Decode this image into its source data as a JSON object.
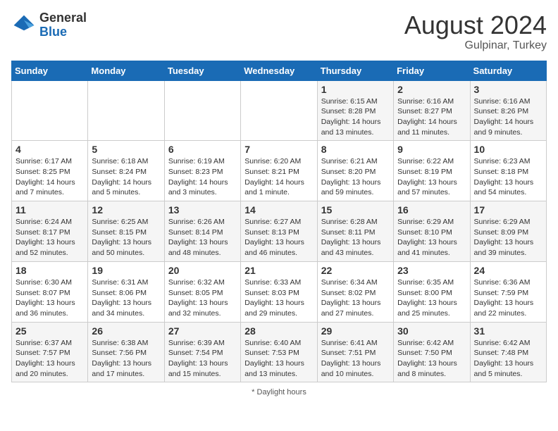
{
  "header": {
    "logo_general": "General",
    "logo_blue": "Blue",
    "month_year": "August 2024",
    "location": "Gulpinar, Turkey"
  },
  "days_of_week": [
    "Sunday",
    "Monday",
    "Tuesday",
    "Wednesday",
    "Thursday",
    "Friday",
    "Saturday"
  ],
  "weeks": [
    [
      {
        "day": "",
        "info": ""
      },
      {
        "day": "",
        "info": ""
      },
      {
        "day": "",
        "info": ""
      },
      {
        "day": "",
        "info": ""
      },
      {
        "day": "1",
        "info": "Sunrise: 6:15 AM\nSunset: 8:28 PM\nDaylight: 14 hours and 13 minutes."
      },
      {
        "day": "2",
        "info": "Sunrise: 6:16 AM\nSunset: 8:27 PM\nDaylight: 14 hours and 11 minutes."
      },
      {
        "day": "3",
        "info": "Sunrise: 6:16 AM\nSunset: 8:26 PM\nDaylight: 14 hours and 9 minutes."
      }
    ],
    [
      {
        "day": "4",
        "info": "Sunrise: 6:17 AM\nSunset: 8:25 PM\nDaylight: 14 hours and 7 minutes."
      },
      {
        "day": "5",
        "info": "Sunrise: 6:18 AM\nSunset: 8:24 PM\nDaylight: 14 hours and 5 minutes."
      },
      {
        "day": "6",
        "info": "Sunrise: 6:19 AM\nSunset: 8:23 PM\nDaylight: 14 hours and 3 minutes."
      },
      {
        "day": "7",
        "info": "Sunrise: 6:20 AM\nSunset: 8:21 PM\nDaylight: 14 hours and 1 minute."
      },
      {
        "day": "8",
        "info": "Sunrise: 6:21 AM\nSunset: 8:20 PM\nDaylight: 13 hours and 59 minutes."
      },
      {
        "day": "9",
        "info": "Sunrise: 6:22 AM\nSunset: 8:19 PM\nDaylight: 13 hours and 57 minutes."
      },
      {
        "day": "10",
        "info": "Sunrise: 6:23 AM\nSunset: 8:18 PM\nDaylight: 13 hours and 54 minutes."
      }
    ],
    [
      {
        "day": "11",
        "info": "Sunrise: 6:24 AM\nSunset: 8:17 PM\nDaylight: 13 hours and 52 minutes."
      },
      {
        "day": "12",
        "info": "Sunrise: 6:25 AM\nSunset: 8:15 PM\nDaylight: 13 hours and 50 minutes."
      },
      {
        "day": "13",
        "info": "Sunrise: 6:26 AM\nSunset: 8:14 PM\nDaylight: 13 hours and 48 minutes."
      },
      {
        "day": "14",
        "info": "Sunrise: 6:27 AM\nSunset: 8:13 PM\nDaylight: 13 hours and 46 minutes."
      },
      {
        "day": "15",
        "info": "Sunrise: 6:28 AM\nSunset: 8:11 PM\nDaylight: 13 hours and 43 minutes."
      },
      {
        "day": "16",
        "info": "Sunrise: 6:29 AM\nSunset: 8:10 PM\nDaylight: 13 hours and 41 minutes."
      },
      {
        "day": "17",
        "info": "Sunrise: 6:29 AM\nSunset: 8:09 PM\nDaylight: 13 hours and 39 minutes."
      }
    ],
    [
      {
        "day": "18",
        "info": "Sunrise: 6:30 AM\nSunset: 8:07 PM\nDaylight: 13 hours and 36 minutes."
      },
      {
        "day": "19",
        "info": "Sunrise: 6:31 AM\nSunset: 8:06 PM\nDaylight: 13 hours and 34 minutes."
      },
      {
        "day": "20",
        "info": "Sunrise: 6:32 AM\nSunset: 8:05 PM\nDaylight: 13 hours and 32 minutes."
      },
      {
        "day": "21",
        "info": "Sunrise: 6:33 AM\nSunset: 8:03 PM\nDaylight: 13 hours and 29 minutes."
      },
      {
        "day": "22",
        "info": "Sunrise: 6:34 AM\nSunset: 8:02 PM\nDaylight: 13 hours and 27 minutes."
      },
      {
        "day": "23",
        "info": "Sunrise: 6:35 AM\nSunset: 8:00 PM\nDaylight: 13 hours and 25 minutes."
      },
      {
        "day": "24",
        "info": "Sunrise: 6:36 AM\nSunset: 7:59 PM\nDaylight: 13 hours and 22 minutes."
      }
    ],
    [
      {
        "day": "25",
        "info": "Sunrise: 6:37 AM\nSunset: 7:57 PM\nDaylight: 13 hours and 20 minutes."
      },
      {
        "day": "26",
        "info": "Sunrise: 6:38 AM\nSunset: 7:56 PM\nDaylight: 13 hours and 17 minutes."
      },
      {
        "day": "27",
        "info": "Sunrise: 6:39 AM\nSunset: 7:54 PM\nDaylight: 13 hours and 15 minutes."
      },
      {
        "day": "28",
        "info": "Sunrise: 6:40 AM\nSunset: 7:53 PM\nDaylight: 13 hours and 13 minutes."
      },
      {
        "day": "29",
        "info": "Sunrise: 6:41 AM\nSunset: 7:51 PM\nDaylight: 13 hours and 10 minutes."
      },
      {
        "day": "30",
        "info": "Sunrise: 6:42 AM\nSunset: 7:50 PM\nDaylight: 13 hours and 8 minutes."
      },
      {
        "day": "31",
        "info": "Sunrise: 6:42 AM\nSunset: 7:48 PM\nDaylight: 13 hours and 5 minutes."
      }
    ]
  ],
  "footer": "Daylight hours"
}
